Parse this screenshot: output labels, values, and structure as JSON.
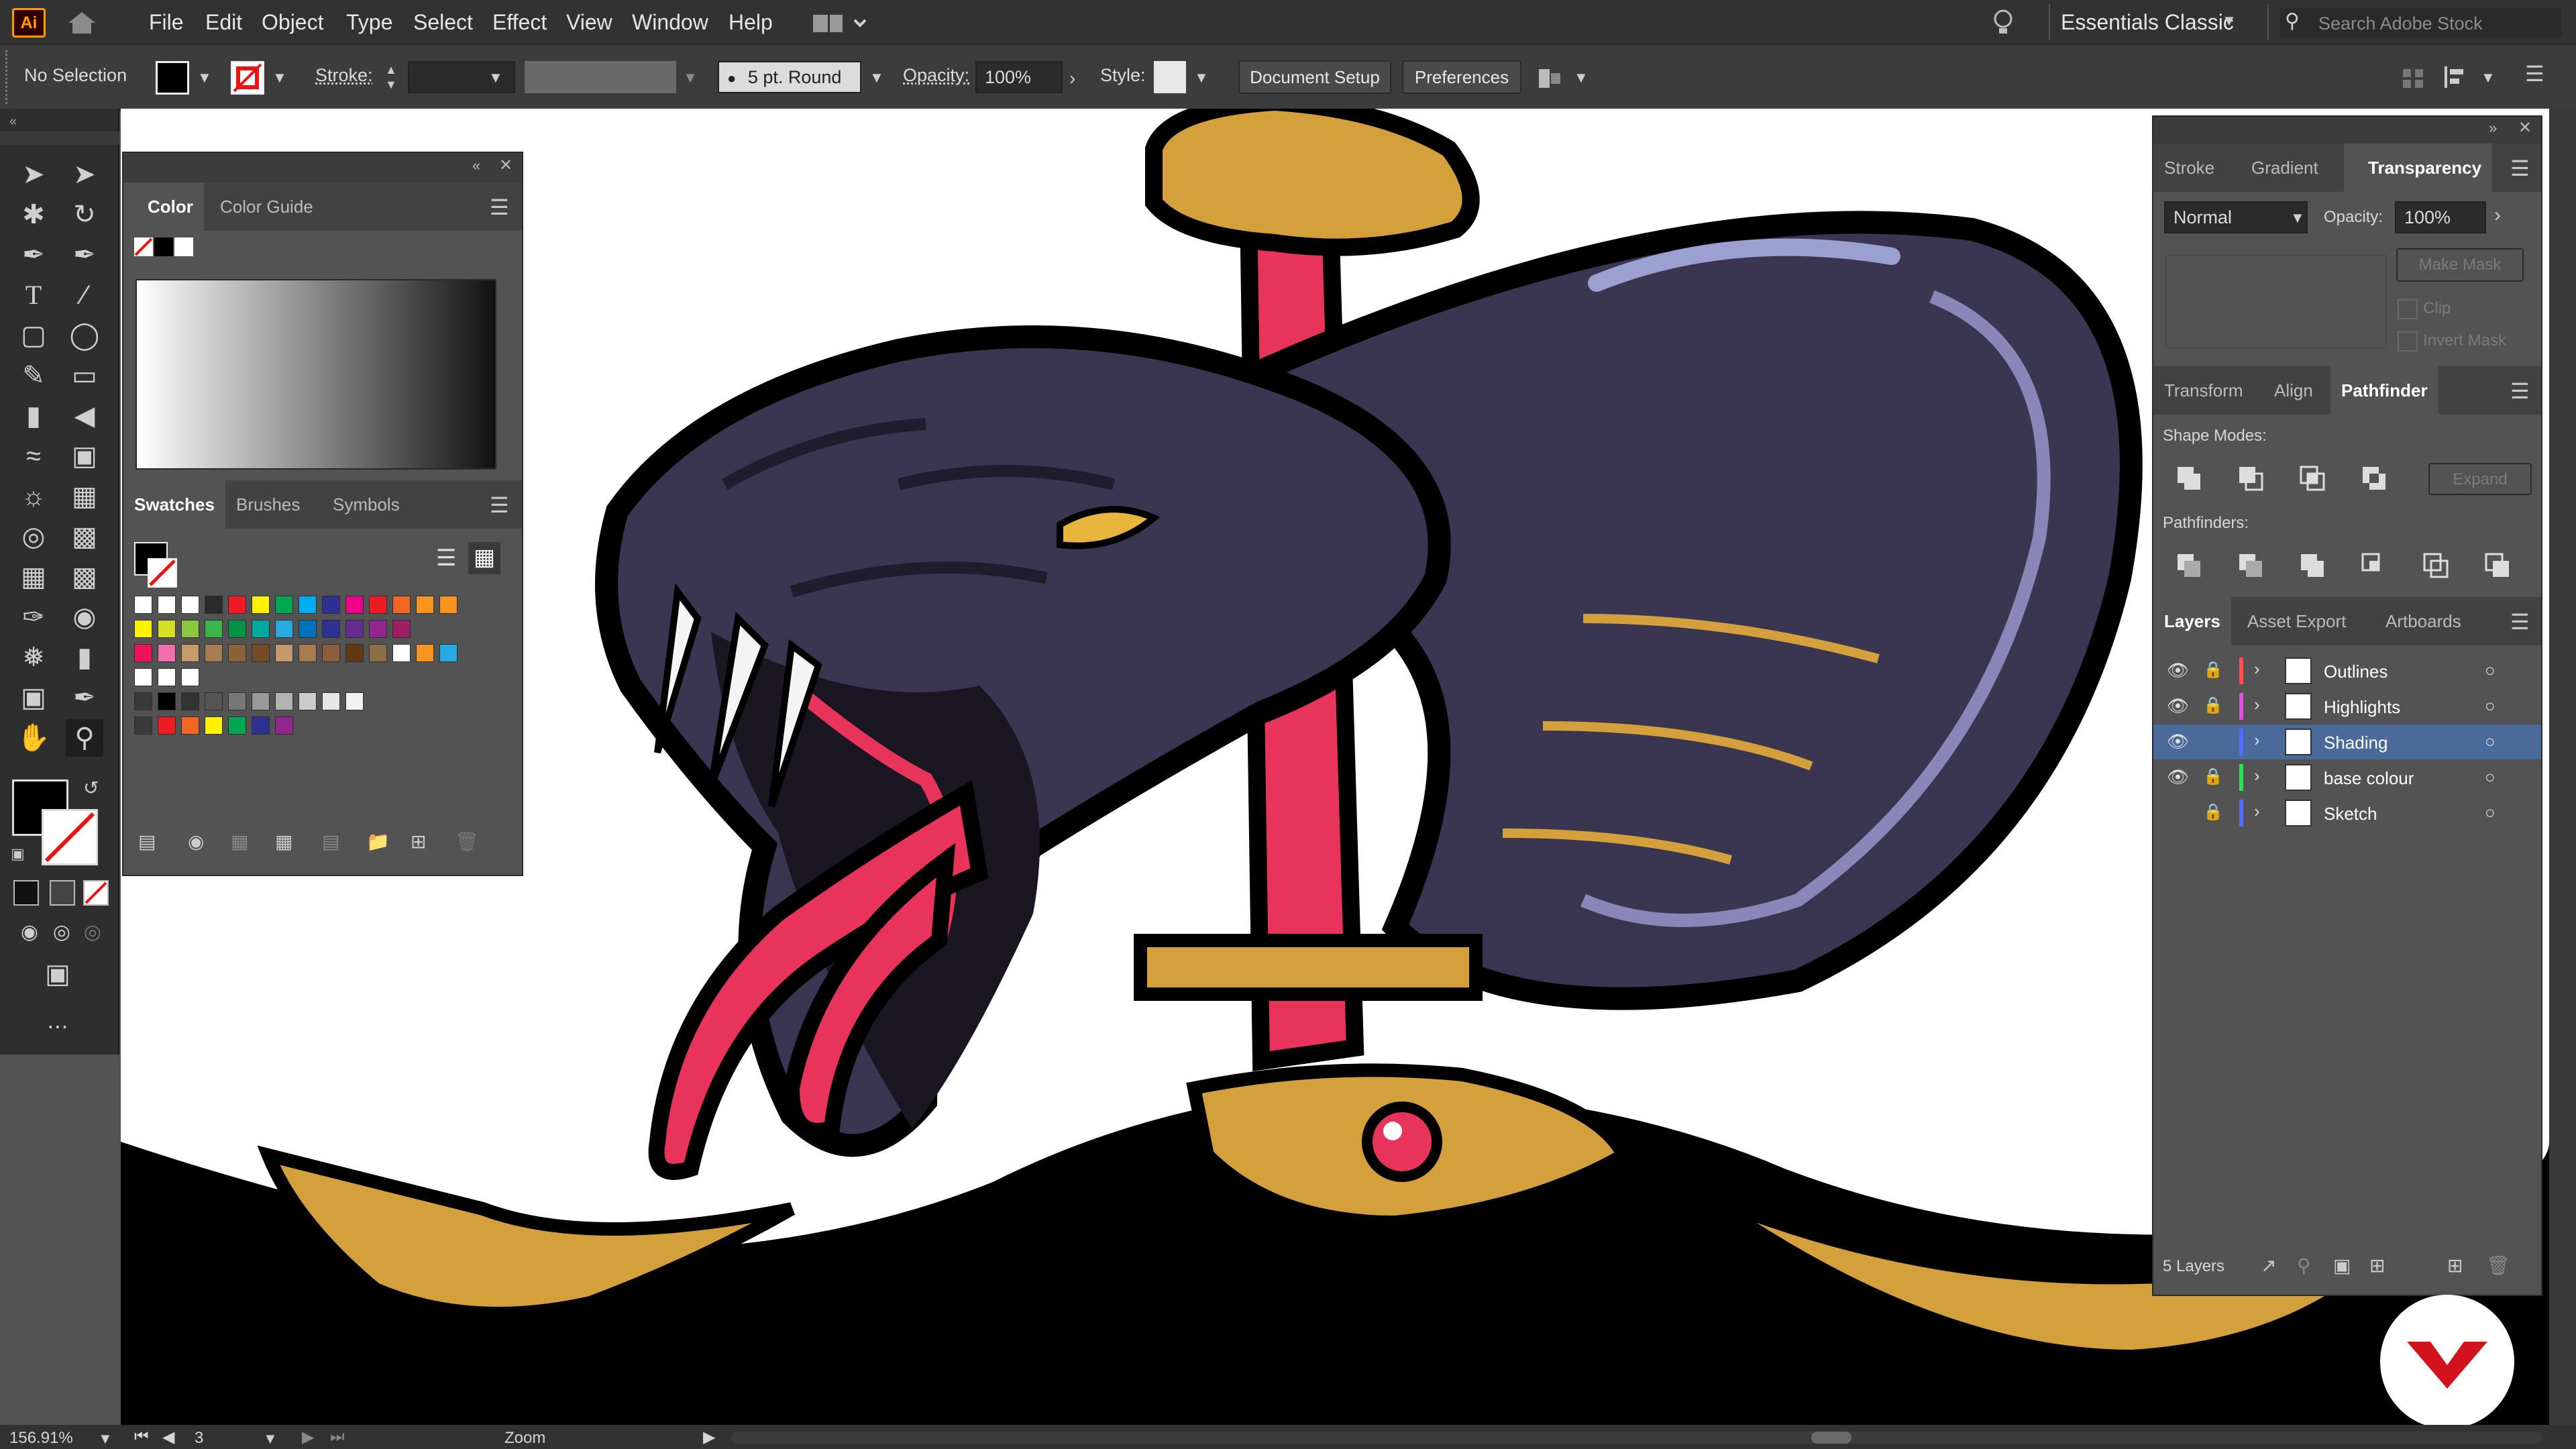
{
  "app": {
    "logo": "Ai",
    "menu": [
      "File",
      "Edit",
      "Object",
      "Type",
      "Select",
      "Effect",
      "View",
      "Window",
      "Help"
    ],
    "workspace": "Essentials Classic",
    "search_placeholder": "Search Adobe Stock",
    "home_icon": "home-icon",
    "layout_icon": "arrange-documents-icon",
    "lightbulb_icon": "lightbulb-icon"
  },
  "control_bar": {
    "selection": "No Selection",
    "stroke_label": "Stroke:",
    "brush": "5 pt. Round",
    "opacity_label": "Opacity:",
    "opacity_value": "100%",
    "style_label": "Style:",
    "document_setup": "Document Setup",
    "preferences": "Preferences"
  },
  "color_panel": {
    "tabs": [
      "Color",
      "Color Guide"
    ]
  },
  "swatches_panel": {
    "tabs": [
      "Swatches",
      "Brushes",
      "Symbols"
    ],
    "rows": [
      [
        "#ffffff",
        "#ffffff",
        "#ffffff",
        "#2b2b2b",
        "#ed1c24",
        "#fff200",
        "#00a651",
        "#00aeef",
        "#2e3192",
        "#ec008c",
        "#ed1c24",
        "#f26522",
        "#f7941d",
        "#f7941d"
      ],
      [
        "#fff200",
        "#d7df23",
        "#8dc63f",
        "#39b54a",
        "#009444",
        "#00a99d",
        "#27aae1",
        "#0072bc",
        "#2e3192",
        "#662d91",
        "#92278f",
        "#9e1f63"
      ],
      [
        "#ed145b",
        "#f06eaa",
        "#c69c6d",
        "#a67c52",
        "#8c6239",
        "#754c24",
        "#c49a6c",
        "#a97c50",
        "#8b5e3c",
        "#603913",
        "#8b6f47",
        "#ffffff",
        "#f7941d",
        "#27aae1"
      ],
      [
        "#ffffff",
        "#ffffff",
        "#ffffff"
      ],
      [
        "#3a3a3a",
        "#000000",
        "#333333",
        "#555555",
        "#777777",
        "#999999",
        "#b3b3b3",
        "#cccccc",
        "#e6e6e6",
        "#f2f2f2"
      ],
      [
        "#3a3a3a",
        "#ed1c24",
        "#f26522",
        "#fff200",
        "#00a651",
        "#2e3192",
        "#92278f"
      ]
    ]
  },
  "right_panel_top": {
    "tabs": [
      "Stroke",
      "Gradient",
      "Transparency"
    ],
    "blend_mode": "Normal",
    "opacity_label": "Opacity:",
    "opacity_value": "100%",
    "make_mask": "Make Mask",
    "clip": "Clip",
    "invert_mask": "Invert Mask"
  },
  "pathfinder_panel": {
    "tabs": [
      "Transform",
      "Align",
      "Pathfinder"
    ],
    "shape_modes_label": "Shape Modes:",
    "expand": "Expand",
    "pathfinders_label": "Pathfinders:"
  },
  "layers_panel": {
    "tabs": [
      "Layers",
      "Asset Export",
      "Artboards"
    ],
    "layers": [
      {
        "name": "Outlines",
        "color": "#ff4f4f",
        "visible": true,
        "locked": true,
        "selected": false
      },
      {
        "name": "Highlights",
        "color": "#e04fe0",
        "visible": true,
        "locked": true,
        "selected": false
      },
      {
        "name": "Shading",
        "color": "#4f6dff",
        "visible": true,
        "locked": false,
        "selected": true
      },
      {
        "name": "base colour",
        "color": "#33dd55",
        "visible": true,
        "locked": true,
        "selected": false
      },
      {
        "name": "Sketch",
        "color": "#4f6dff",
        "visible": false,
        "locked": true,
        "selected": false
      }
    ],
    "count": "5 Layers"
  },
  "status_bar": {
    "zoom": "156.91%",
    "artboard": "3",
    "tool": "Zoom"
  },
  "colors": {
    "snake_body": "#3a3550",
    "snake_red": "#e8335a",
    "gold": "#d4a03c",
    "outline": "#000000"
  }
}
